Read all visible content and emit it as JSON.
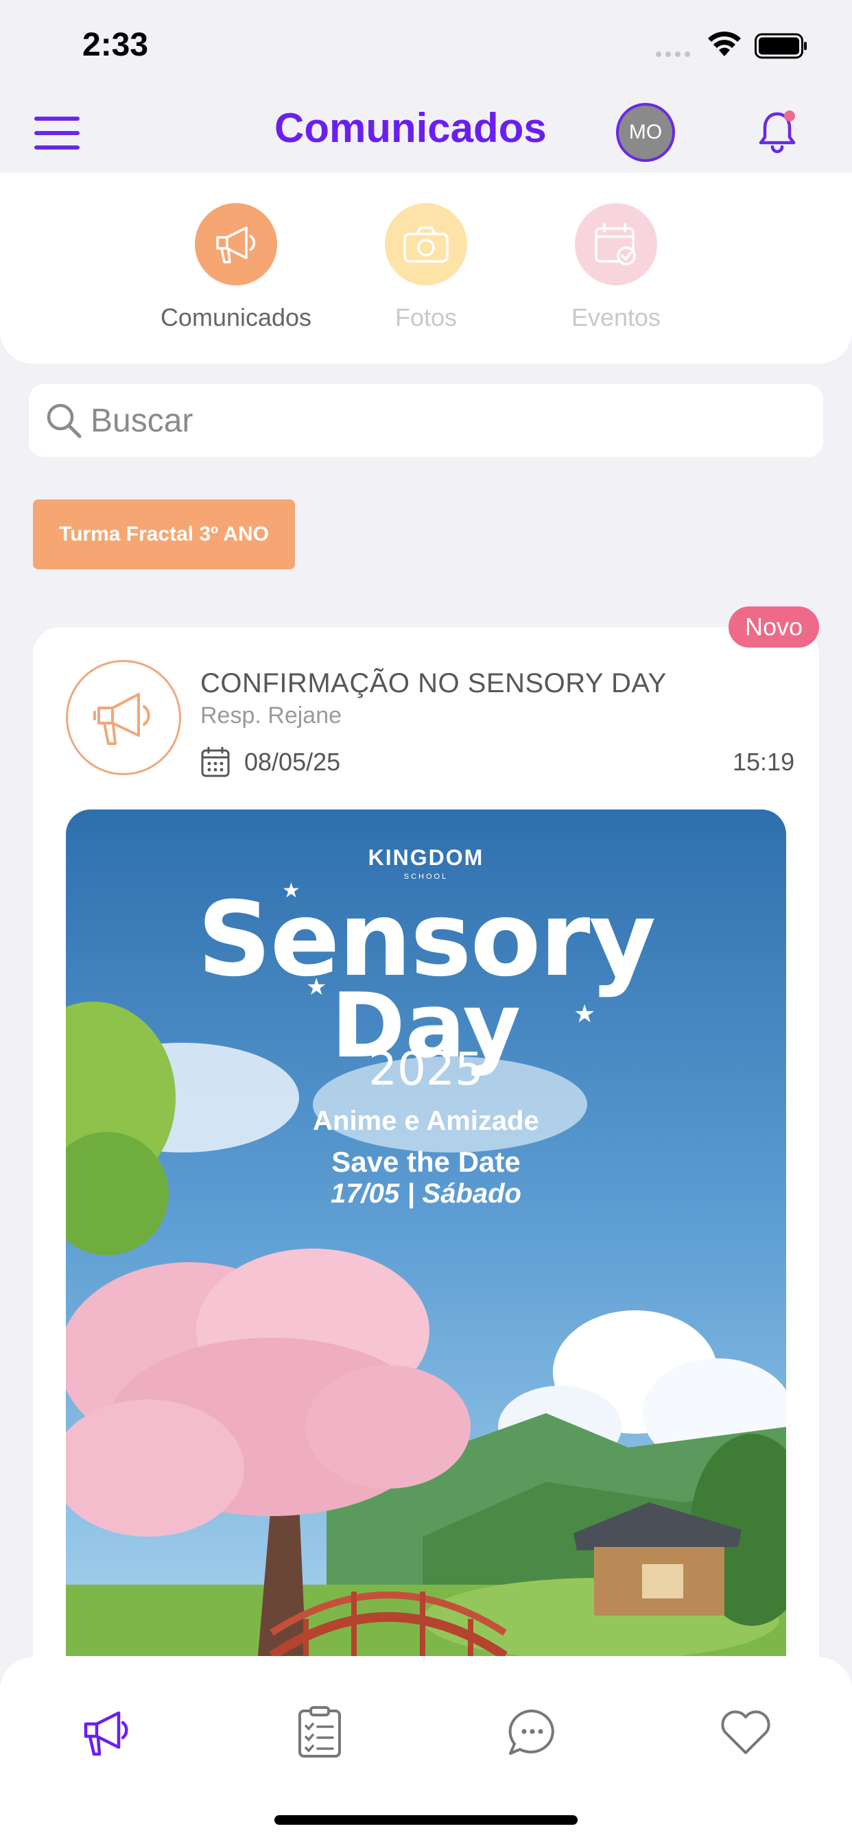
{
  "status_bar": {
    "time": "2:33"
  },
  "header": {
    "title": "Comunicados",
    "avatar_initials": "MO",
    "accent_color": "#6a1ff0",
    "has_notification": true
  },
  "categories": [
    {
      "label": "Comunicados",
      "icon": "megaphone-icon",
      "color": "#f5a673",
      "active": true
    },
    {
      "label": "Fotos",
      "icon": "camera-icon",
      "color": "#fde3a7",
      "active": false
    },
    {
      "label": "Eventos",
      "icon": "calendar-check-icon",
      "color": "#f8d5dd",
      "active": false
    }
  ],
  "search": {
    "placeholder": "Buscar",
    "value": ""
  },
  "class_filter": {
    "label": "Turma Fractal 3º ANO"
  },
  "post": {
    "badge": "Novo",
    "title": "CONFIRMAÇÃO NO SENSORY DAY",
    "author": "Resp. Rejane",
    "date": "08/05/25",
    "time": "15:19",
    "poster": {
      "brand": "KINGDOM",
      "brand_sub": "SCHOOL",
      "headline_1": "Sensory",
      "headline_2": "Day",
      "year": "2025",
      "theme": "Anime e Amizade",
      "save_the_date": "Save the Date",
      "event_date": "17/05 | Sábado"
    }
  },
  "tabbar": [
    {
      "icon": "megaphone-icon",
      "active": true
    },
    {
      "icon": "checklist-icon",
      "active": false
    },
    {
      "icon": "chat-icon",
      "active": false
    },
    {
      "icon": "heart-icon",
      "active": false
    }
  ]
}
